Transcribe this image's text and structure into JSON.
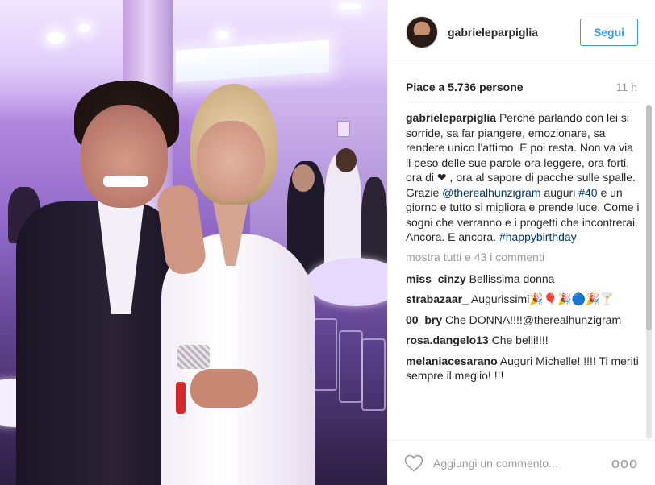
{
  "post": {
    "photo_alt": "Party photo",
    "username": "gabrieleparpiglia",
    "follow_label": "Segui",
    "likes_text": "Piace a 5.736 persone",
    "time_ago": "11 h"
  },
  "caption": {
    "username": "gabrieleparpiglia",
    "text_part1": "Perché parlando con lei si sorride, sa far piangere, emozionare, sa rendere unico l'attimo. E poi resta. Non va via il peso delle sue parole ora leggere, ora forti, ora di ",
    "heart_glyph": "❤",
    "text_part2": " , ora al sapore di pacche sulle spalle. Grazie ",
    "mention": "@therealhunzigram",
    "text_part3": " auguri ",
    "hashtag1": "#40",
    "text_part4": " e un giorno e tutto si migliora e prende luce. Come i sogni che verranno e i progetti che incontrerai. Ancora. E ancora. ",
    "hashtag2": "#happybirthday"
  },
  "show_all_comments": "mostra tutti e 43 i commenti",
  "comments": [
    {
      "user": "miss_cinzy",
      "text": "Bellissima donna"
    },
    {
      "user": "strabazaar_",
      "text": "Augurissimi🎉🎈🎉🔵🎉🍸"
    },
    {
      "user": "00_bry",
      "text": "Che DONNA!!!!@therealhunzigram"
    },
    {
      "user": "rosa.dangelo13",
      "text": "Che belli!!!!"
    },
    {
      "user": "melaniacesarano",
      "text": "Auguri Michelle! !!!! Ti meriti sempre il meglio! !!!"
    }
  ],
  "footer": {
    "like_icon": "heart-outline-icon",
    "add_comment_placeholder": "Aggiungi un commento...",
    "more_glyph": "ooo"
  }
}
